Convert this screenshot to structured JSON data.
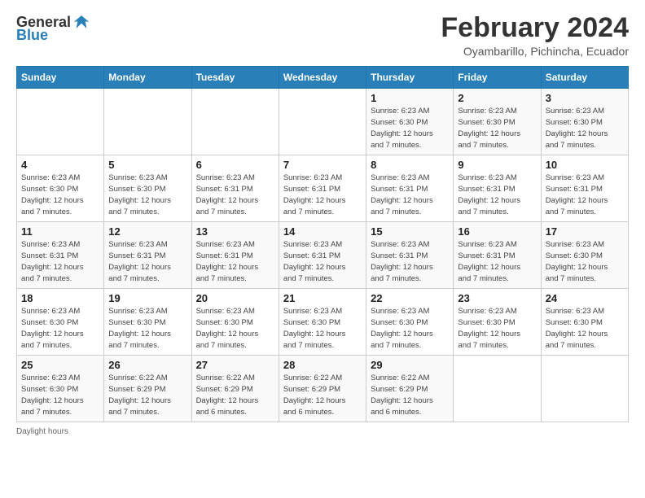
{
  "logo": {
    "text_general": "General",
    "text_blue": "Blue",
    "icon_color": "#2980b9"
  },
  "header": {
    "title": "February 2024",
    "subtitle": "Oyambarillo, Pichincha, Ecuador"
  },
  "days_of_week": [
    "Sunday",
    "Monday",
    "Tuesday",
    "Wednesday",
    "Thursday",
    "Friday",
    "Saturday"
  ],
  "footer": {
    "daylight_label": "Daylight hours"
  },
  "weeks": [
    {
      "days": [
        {
          "num": "",
          "info": ""
        },
        {
          "num": "",
          "info": ""
        },
        {
          "num": "",
          "info": ""
        },
        {
          "num": "",
          "info": ""
        },
        {
          "num": "1",
          "info": "Sunrise: 6:23 AM\nSunset: 6:30 PM\nDaylight: 12 hours\nand 7 minutes."
        },
        {
          "num": "2",
          "info": "Sunrise: 6:23 AM\nSunset: 6:30 PM\nDaylight: 12 hours\nand 7 minutes."
        },
        {
          "num": "3",
          "info": "Sunrise: 6:23 AM\nSunset: 6:30 PM\nDaylight: 12 hours\nand 7 minutes."
        }
      ]
    },
    {
      "days": [
        {
          "num": "4",
          "info": "Sunrise: 6:23 AM\nSunset: 6:30 PM\nDaylight: 12 hours\nand 7 minutes."
        },
        {
          "num": "5",
          "info": "Sunrise: 6:23 AM\nSunset: 6:30 PM\nDaylight: 12 hours\nand 7 minutes."
        },
        {
          "num": "6",
          "info": "Sunrise: 6:23 AM\nSunset: 6:31 PM\nDaylight: 12 hours\nand 7 minutes."
        },
        {
          "num": "7",
          "info": "Sunrise: 6:23 AM\nSunset: 6:31 PM\nDaylight: 12 hours\nand 7 minutes."
        },
        {
          "num": "8",
          "info": "Sunrise: 6:23 AM\nSunset: 6:31 PM\nDaylight: 12 hours\nand 7 minutes."
        },
        {
          "num": "9",
          "info": "Sunrise: 6:23 AM\nSunset: 6:31 PM\nDaylight: 12 hours\nand 7 minutes."
        },
        {
          "num": "10",
          "info": "Sunrise: 6:23 AM\nSunset: 6:31 PM\nDaylight: 12 hours\nand 7 minutes."
        }
      ]
    },
    {
      "days": [
        {
          "num": "11",
          "info": "Sunrise: 6:23 AM\nSunset: 6:31 PM\nDaylight: 12 hours\nand 7 minutes."
        },
        {
          "num": "12",
          "info": "Sunrise: 6:23 AM\nSunset: 6:31 PM\nDaylight: 12 hours\nand 7 minutes."
        },
        {
          "num": "13",
          "info": "Sunrise: 6:23 AM\nSunset: 6:31 PM\nDaylight: 12 hours\nand 7 minutes."
        },
        {
          "num": "14",
          "info": "Sunrise: 6:23 AM\nSunset: 6:31 PM\nDaylight: 12 hours\nand 7 minutes."
        },
        {
          "num": "15",
          "info": "Sunrise: 6:23 AM\nSunset: 6:31 PM\nDaylight: 12 hours\nand 7 minutes."
        },
        {
          "num": "16",
          "info": "Sunrise: 6:23 AM\nSunset: 6:31 PM\nDaylight: 12 hours\nand 7 minutes."
        },
        {
          "num": "17",
          "info": "Sunrise: 6:23 AM\nSunset: 6:30 PM\nDaylight: 12 hours\nand 7 minutes."
        }
      ]
    },
    {
      "days": [
        {
          "num": "18",
          "info": "Sunrise: 6:23 AM\nSunset: 6:30 PM\nDaylight: 12 hours\nand 7 minutes."
        },
        {
          "num": "19",
          "info": "Sunrise: 6:23 AM\nSunset: 6:30 PM\nDaylight: 12 hours\nand 7 minutes."
        },
        {
          "num": "20",
          "info": "Sunrise: 6:23 AM\nSunset: 6:30 PM\nDaylight: 12 hours\nand 7 minutes."
        },
        {
          "num": "21",
          "info": "Sunrise: 6:23 AM\nSunset: 6:30 PM\nDaylight: 12 hours\nand 7 minutes."
        },
        {
          "num": "22",
          "info": "Sunrise: 6:23 AM\nSunset: 6:30 PM\nDaylight: 12 hours\nand 7 minutes."
        },
        {
          "num": "23",
          "info": "Sunrise: 6:23 AM\nSunset: 6:30 PM\nDaylight: 12 hours\nand 7 minutes."
        },
        {
          "num": "24",
          "info": "Sunrise: 6:23 AM\nSunset: 6:30 PM\nDaylight: 12 hours\nand 7 minutes."
        }
      ]
    },
    {
      "days": [
        {
          "num": "25",
          "info": "Sunrise: 6:23 AM\nSunset: 6:30 PM\nDaylight: 12 hours\nand 7 minutes."
        },
        {
          "num": "26",
          "info": "Sunrise: 6:22 AM\nSunset: 6:29 PM\nDaylight: 12 hours\nand 7 minutes."
        },
        {
          "num": "27",
          "info": "Sunrise: 6:22 AM\nSunset: 6:29 PM\nDaylight: 12 hours\nand 6 minutes."
        },
        {
          "num": "28",
          "info": "Sunrise: 6:22 AM\nSunset: 6:29 PM\nDaylight: 12 hours\nand 6 minutes."
        },
        {
          "num": "29",
          "info": "Sunrise: 6:22 AM\nSunset: 6:29 PM\nDaylight: 12 hours\nand 6 minutes."
        },
        {
          "num": "",
          "info": ""
        },
        {
          "num": "",
          "info": ""
        }
      ]
    }
  ]
}
